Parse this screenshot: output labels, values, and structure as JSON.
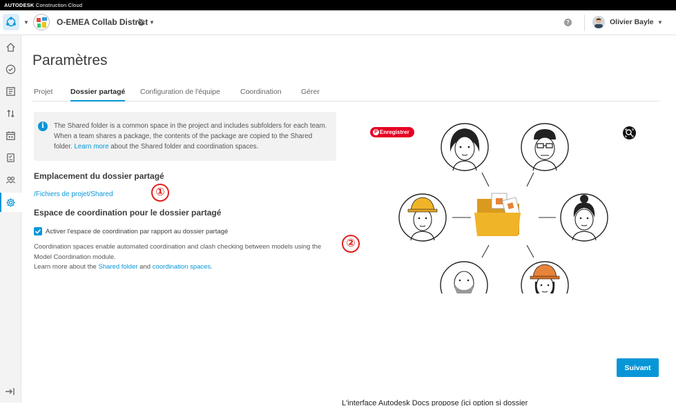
{
  "brand": {
    "bold": "AUTODESK",
    "rest": " Construction Cloud"
  },
  "header": {
    "project_name": "O-EMEA Collab District",
    "help_label": "?",
    "user_name": "Olivier Bayle"
  },
  "icons": {
    "app_switcher": "hub-icon",
    "globe": "globe-icon",
    "sidebar": [
      "home-icon",
      "check-circle-icon",
      "sheets-icon",
      "transfer-icon",
      "calendar-icon",
      "forms-icon",
      "members-icon",
      "settings-icon"
    ],
    "expand": "expand-sidebar-icon"
  },
  "page": {
    "title": "Paramètres"
  },
  "tabs": [
    {
      "label": "Projet"
    },
    {
      "label": "Dossier partagé"
    },
    {
      "label": "Configuration de l'équipe"
    },
    {
      "label": "Coordination"
    },
    {
      "label": "Gérer"
    }
  ],
  "info": {
    "text_before": "The Shared folder is a common space in the project and includes subfolders for each team. When a team shares a package, the contents of the package are copied to the Shared folder. ",
    "link": "Learn more",
    "text_after": " about the Shared folder and coordination spaces."
  },
  "location": {
    "heading": "Emplacement du dossier partagé",
    "path": "/Fichiers de projet/Shared"
  },
  "coordination": {
    "heading": "Espace de coordination pour le dossier partagé",
    "checkbox_label": "Activer l'espace de coordination par rapport au dossier partagé",
    "checked": true,
    "description": "Coordination spaces enable automated coordination and clash checking between models using the Model Coordination module.",
    "learn_prefix": "Learn more about the ",
    "link_shared": "Shared folder",
    "and": " and ",
    "link_spaces": "coordination spaces",
    "period": "."
  },
  "annotations": [
    "①",
    "②"
  ],
  "pinterest_label": "Enregistrer",
  "footer": {
    "next_button": "Suivant",
    "overflow_text": "L'interface Autodesk Docs propose (ici option si dossier"
  },
  "colors": {
    "accent": "#0696d7",
    "annotation_red": "#e0201c",
    "pinterest": "#e60023",
    "folder": "#f0b429"
  }
}
